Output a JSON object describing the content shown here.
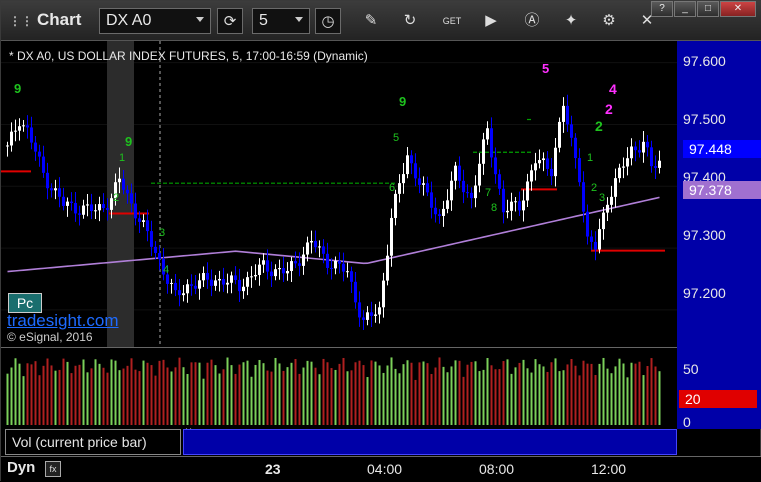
{
  "toolbar": {
    "title": "Chart",
    "symbol": "DX A0",
    "interval": "5",
    "buttons": [
      "refresh-icon",
      "clock-icon",
      "pencil-icon",
      "cycle-icon",
      "get-icon",
      "play-icon",
      "text-icon",
      "tag-icon",
      "gear-icon",
      "close-icon"
    ]
  },
  "window_controls": [
    "?",
    "_",
    "□",
    "✕"
  ],
  "chart_title": "* DX A0, US DOLLAR INDEX FUTURES, 5, 17:00-16:59 (Dynamic)",
  "watermark": "tradesight.com",
  "copyright": "© eSignal, 2016",
  "badge": "Pc",
  "price_labels": [
    "97.600",
    "97.500",
    "97.400",
    "97.300",
    "97.200"
  ],
  "current_price": "97.448",
  "ma_price": "97.378",
  "volume_labels": [
    "50",
    "20",
    "0"
  ],
  "volume_legend": "Vol (current price bar)",
  "volume_legend_close": "×",
  "time_labels": [
    "23",
    "04:00",
    "08:00",
    "12:00"
  ],
  "status": "Dyn",
  "colors": {
    "background": "#000000",
    "axis_bg": "#0000a8",
    "up_candle": "#ffffff",
    "down_candle": "#0000ff",
    "ma": "#b07fd8",
    "level_red": "#e00000",
    "level_green": "#00a000",
    "volume_up": "#7bd05a",
    "volume_down": "#b02020",
    "setup_green": "#1ec21e",
    "setup_magenta": "#ff30ff"
  },
  "chart_data": {
    "type": "candlestick",
    "ylim": [
      97.14,
      97.635
    ],
    "price_ticks": [
      97.6,
      97.5,
      97.4,
      97.3,
      97.2
    ],
    "annotations": [
      {
        "text": "9",
        "color": "green"
      },
      {
        "text": "9",
        "color": "green"
      },
      {
        "text": "9",
        "color": "green"
      },
      {
        "text": "5",
        "color": "magenta"
      },
      {
        "text": "4",
        "color": "magenta"
      },
      {
        "text": "2",
        "color": "magenta"
      },
      {
        "text": "2",
        "color": "green"
      }
    ],
    "levels": [
      {
        "price": 97.424,
        "color": "red"
      },
      {
        "price": 97.405,
        "color": "green"
      },
      {
        "price": 97.455,
        "color": "green"
      },
      {
        "price": 97.508,
        "color": "green"
      },
      {
        "price": 97.356,
        "color": "red"
      },
      {
        "price": 97.395,
        "color": "red"
      },
      {
        "price": 97.296,
        "color": "red"
      }
    ],
    "volume_ylim": [
      0,
      60
    ]
  }
}
